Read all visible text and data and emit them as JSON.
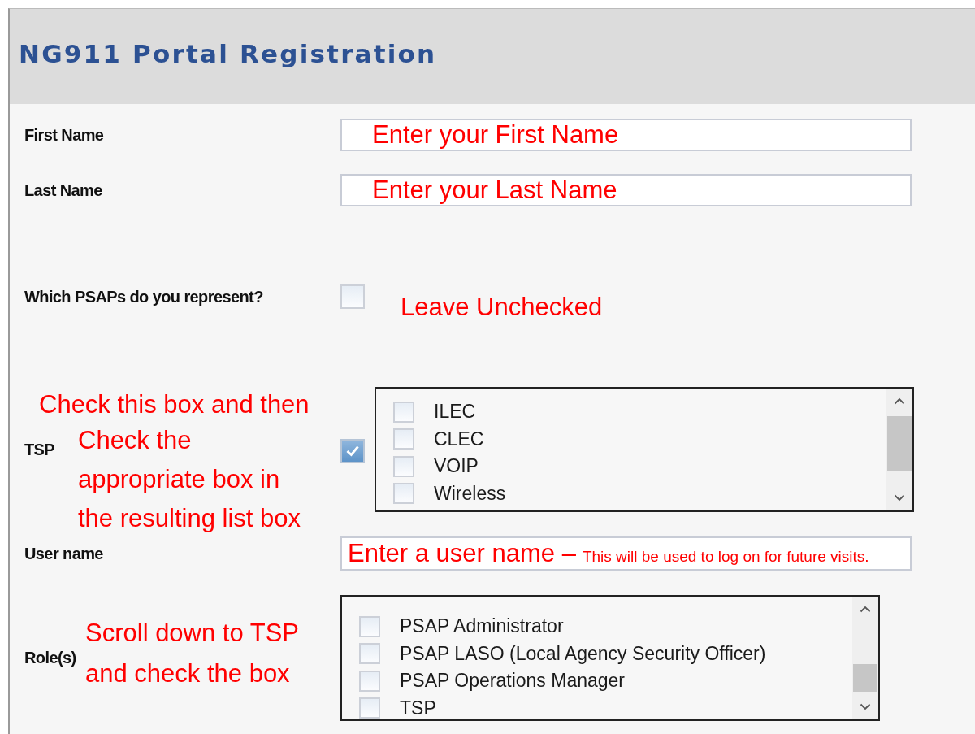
{
  "header": {
    "title": "NG911 Portal Registration"
  },
  "rows": [
    {
      "kind": "text",
      "label": "First Name",
      "note": "Enter your First Name"
    },
    {
      "kind": "text",
      "label": "Last Name",
      "note": "Enter your Last Name"
    },
    {
      "kind": "check",
      "label": "Which PSAPs do you represent?",
      "checked": false,
      "note": "Leave Unchecked"
    },
    {
      "kind": "checklist",
      "label": "TSP",
      "checked": true,
      "note": [
        "Check this box and then",
        "Check the",
        "appropriate box in",
        "the resulting list box"
      ],
      "items": [
        {
          "label": "ILEC",
          "checked": false
        },
        {
          "label": "CLEC",
          "checked": false
        },
        {
          "label": "VOIP",
          "checked": false
        },
        {
          "label": "Wireless",
          "checked": false
        }
      ]
    },
    {
      "kind": "text",
      "label": "User name",
      "note": "Enter a user name –",
      "note_small": "This will be used to log on for future visits."
    },
    {
      "kind": "list",
      "label": "Role(s)",
      "note": [
        "Scroll down to TSP",
        "and check the box"
      ],
      "items": [
        {
          "label": "PSAP Administrator",
          "checked": false
        },
        {
          "label": "PSAP LASO (Local Agency Security Officer)",
          "checked": false
        },
        {
          "label": "PSAP Operations Manager",
          "checked": false
        },
        {
          "label": "TSP",
          "checked": false
        }
      ]
    }
  ]
}
